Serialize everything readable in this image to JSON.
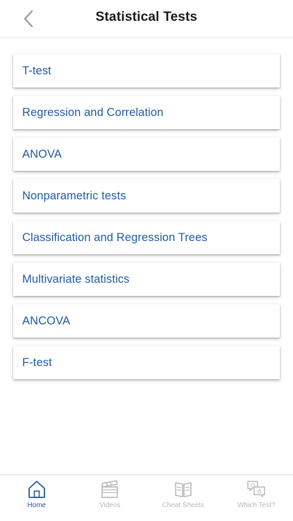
{
  "header": {
    "title": "Statistical Tests",
    "back_icon": "chevron-left-icon"
  },
  "tests": [
    {
      "label": "T-test"
    },
    {
      "label": "Regression and Correlation"
    },
    {
      "label": "ANOVA"
    },
    {
      "label": "Nonparametric tests"
    },
    {
      "label": "Classification and Regression Trees"
    },
    {
      "label": "Multivariate statistics"
    },
    {
      "label": "ANCOVA"
    },
    {
      "label": "F-test"
    }
  ],
  "tabbar": {
    "tabs": [
      {
        "label": "Home",
        "icon": "home-icon",
        "active": true
      },
      {
        "label": "Videos",
        "icon": "clapperboard-icon",
        "active": false
      },
      {
        "label": "Cheat Sheets",
        "icon": "book-icon",
        "active": false
      },
      {
        "label": "Which Test?",
        "icon": "question-answer-icon",
        "active": false
      }
    ]
  },
  "colors": {
    "accent": "#1f5aa6",
    "inactive": "#b8b8b8",
    "title": "#1a1a1a"
  }
}
